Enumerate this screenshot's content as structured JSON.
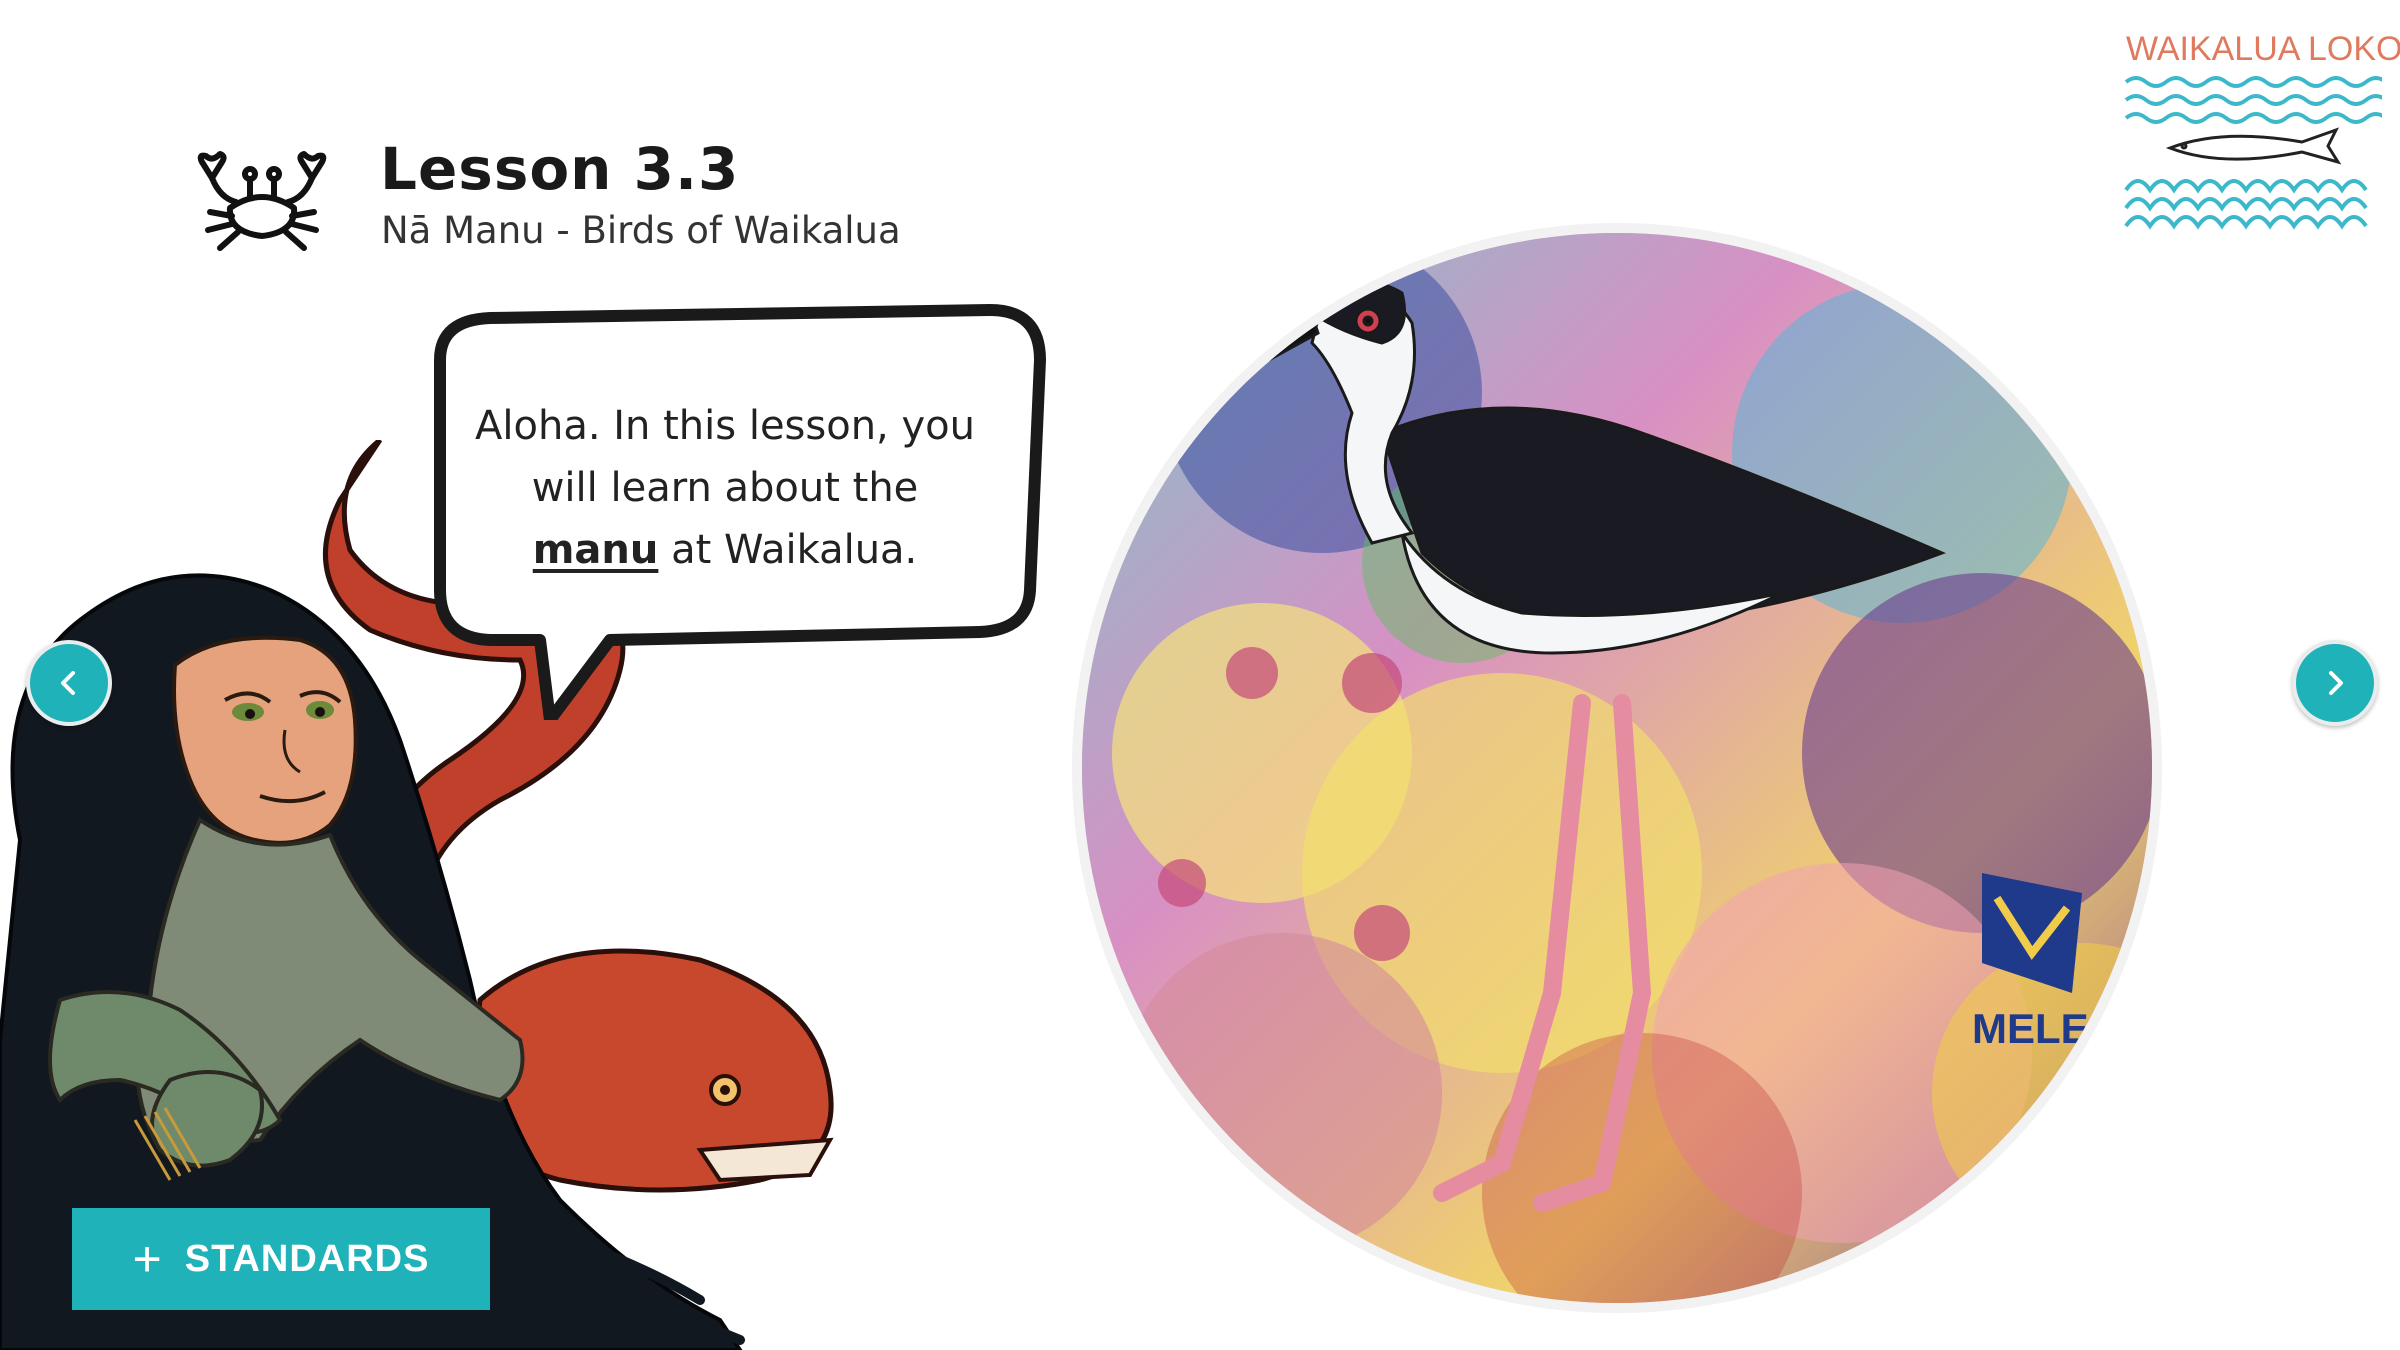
{
  "header": {
    "title": "Lesson 3.3",
    "subtitle": "Nā Manu - Birds of Waikalua",
    "icon": "crab-icon"
  },
  "logo": {
    "text": "WAIKALUA LOKO I'A",
    "text_color": "#e07a5f",
    "wave_color": "#3bb8c9"
  },
  "speech_bubble": {
    "line1": "Aloha. In this lesson, you",
    "line2": "will learn about the",
    "keyword": "manu",
    "line3_rest": " at Waikalua."
  },
  "navigation": {
    "prev_icon": "chevron-left-icon",
    "next_icon": "chevron-right-icon",
    "button_color": "#1fb2b8"
  },
  "standards_button": {
    "icon": "plus-icon",
    "label": "STANDARDS",
    "color": "#1fb2b8"
  },
  "mural": {
    "signature": "MELE MURALS"
  }
}
